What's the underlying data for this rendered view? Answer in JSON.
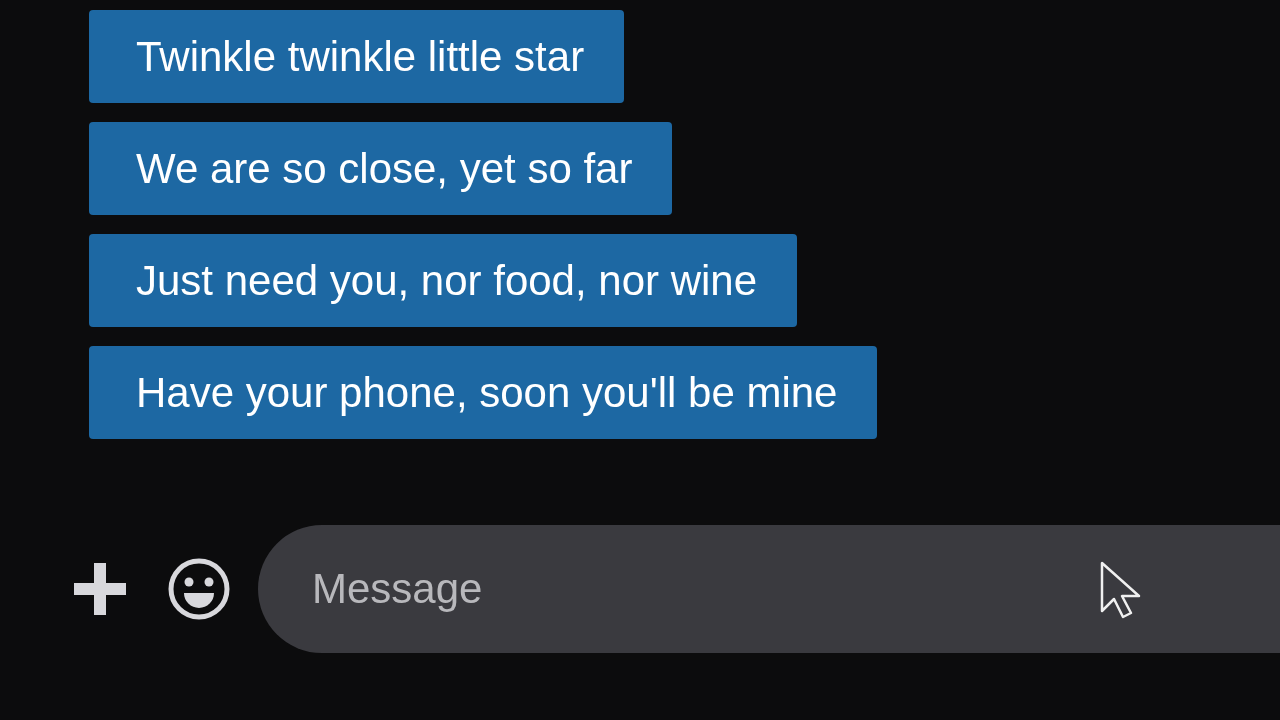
{
  "messages": [
    {
      "text": "Twinkle twinkle little star"
    },
    {
      "text": "We are so close, yet so far"
    },
    {
      "text": "Just need you, nor food, nor wine"
    },
    {
      "text": "Have your phone, soon you'll be mine"
    }
  ],
  "composer": {
    "placeholder": "Message"
  }
}
